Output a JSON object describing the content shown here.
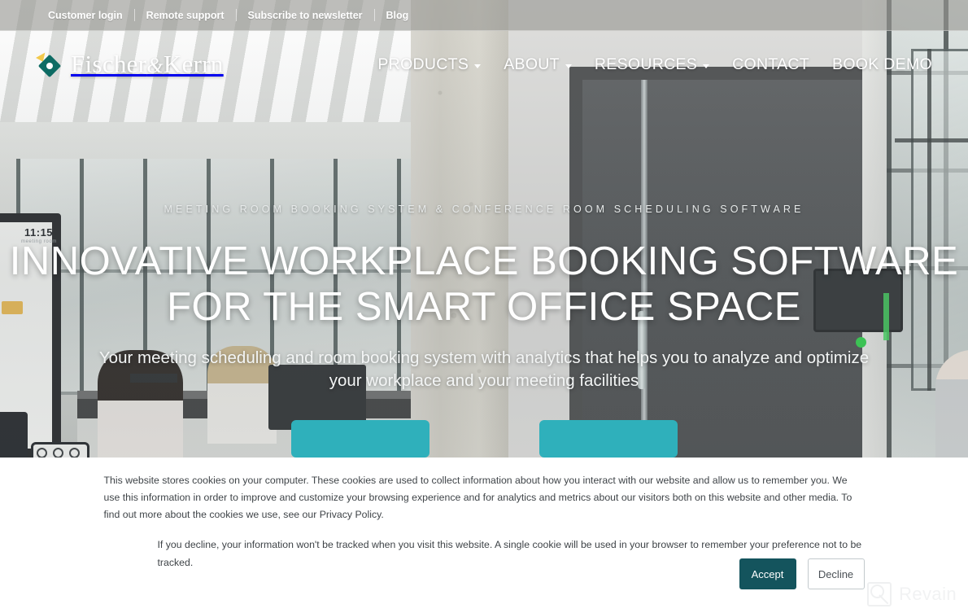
{
  "topbar": {
    "links": [
      {
        "label": "Customer login"
      },
      {
        "label": "Remote support"
      },
      {
        "label": "Subscribe to newsletter"
      },
      {
        "label": "Blog"
      }
    ]
  },
  "brand": {
    "name_part1": "Fischer",
    "amp": "&",
    "name_part2": "Kerrn",
    "logo_colors": {
      "diamond": "#0d6b63",
      "spark": "#f2c94c",
      "center": "#ffffff"
    }
  },
  "nav": {
    "items": [
      {
        "label": "PRODUCTS",
        "has_dropdown": true
      },
      {
        "label": "ABOUT",
        "has_dropdown": true
      },
      {
        "label": "RESOURCES",
        "has_dropdown": true
      },
      {
        "label": "CONTACT",
        "has_dropdown": false
      },
      {
        "label": "BOOK DEMO",
        "has_dropdown": false
      }
    ]
  },
  "hero": {
    "eyebrow": "MEETING ROOM BOOKING SYSTEM & CONFERENCE ROOM SCHEDULING SOFTWARE",
    "headline_line1": "INNOVATIVE WORKPLACE BOOKING SOFTWARE",
    "headline_line2": "FOR THE SMART OFFICE SPACE",
    "subhead_line1": "Your meeting scheduling and room booking system with analytics that helps you to analyze and optimize",
    "subhead_line2": "your workplace and your meeting facilities",
    "cta_primary": "",
    "cta_secondary": "",
    "cta_color": "#2fb0bb",
    "photo": {
      "screen_time": "11:15",
      "screen_subtitle": "meeting room"
    }
  },
  "cookie_banner": {
    "paragraph1": "This website stores cookies on your computer. These cookies are used to collect information about how you interact with our website and allow us to remember you. We use this information in order to improve and customize your browsing experience and for analytics and metrics about our visitors both on this website and other media. To find out more about the cookies we use, see our Privacy Policy.",
    "paragraph2": "If you decline, your information won't be tracked when you visit this website. A single cookie will be used in your browser to remember your preference not to be tracked.",
    "accept_label": "Accept",
    "decline_label": "Decline",
    "accept_color": "#14545d"
  },
  "watermark": {
    "text": "Revain"
  }
}
